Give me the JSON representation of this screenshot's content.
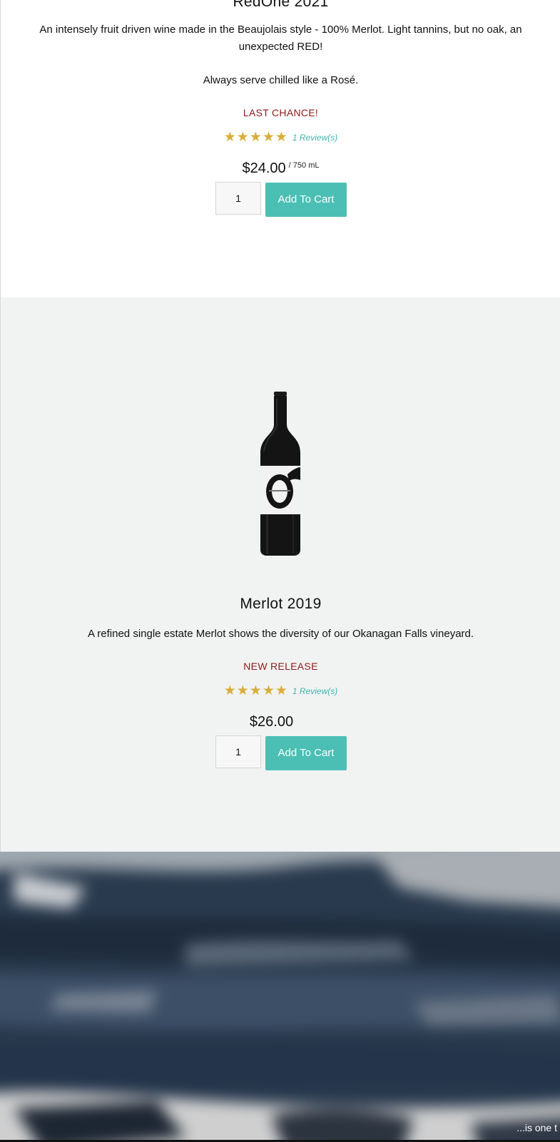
{
  "products": [
    {
      "title": "RedOne 2021",
      "description_1": "An intensely fruit driven wine made in the Beaujolais style - 100% Merlot. Light tannins, but no oak, an unexpected RED!",
      "description_2": "Always serve chilled like a Rosé.",
      "badge": "LAST CHANCE!",
      "stars": "★★★★★",
      "rating": 5,
      "reviews": "1 Review(s)",
      "price": "$24.00",
      "unit": "/ 750 mL",
      "quantity": "1",
      "cart_label": "Add To Cart"
    },
    {
      "title": "Merlot 2019",
      "description_1": "A refined single estate Merlot shows the diversity of our Okanagan Falls vineyard.",
      "badge": "NEW RELEASE",
      "stars": "★★★★★",
      "rating": 5,
      "reviews": "1 Review(s)",
      "price": "$26.00",
      "quantity": "1",
      "cart_label": "Add To Cart"
    }
  ],
  "footer": {
    "caption": "...is one t"
  },
  "colors": {
    "accent": "#4bbfb4",
    "badge": "#8b1a1a",
    "stars": "#d9ae3a",
    "section_alt_bg": "#f1f3f2"
  },
  "icons": {
    "star": "star-icon",
    "bottle": "wine-bottle-image"
  }
}
